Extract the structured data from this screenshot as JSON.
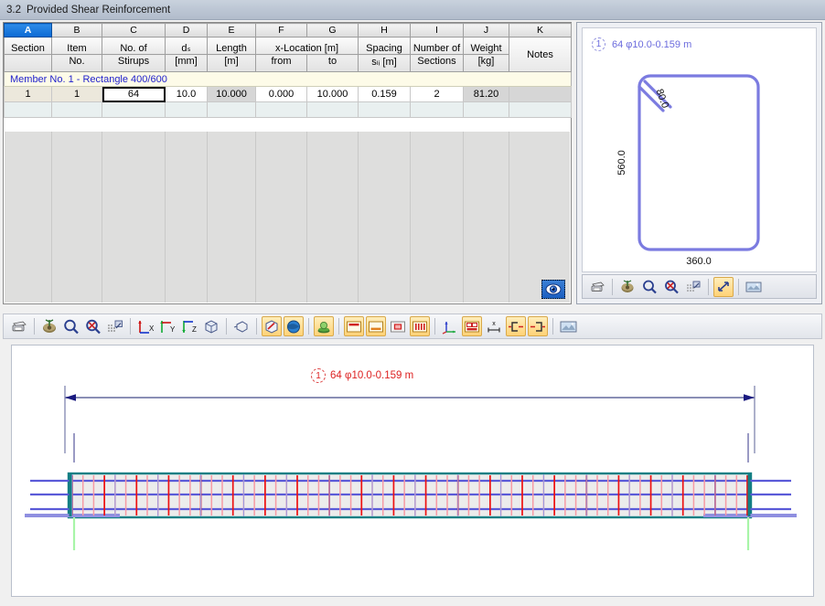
{
  "window": {
    "section_number": "3.2",
    "title": "Provided Shear Reinforcement"
  },
  "table": {
    "column_letters": [
      "A",
      "B",
      "C",
      "D",
      "E",
      "F",
      "G",
      "H",
      "I",
      "J",
      "K"
    ],
    "selected_column_letter": "A",
    "headers_line1": [
      "Section",
      "Item",
      "No. of",
      "d",
      "Length",
      "x-Location [m]",
      "",
      "Spacing",
      "Number of",
      "Weight",
      ""
    ],
    "headers": [
      {
        "l1": "Section",
        "l2": ""
      },
      {
        "l1": "Item",
        "l2": "No."
      },
      {
        "l1": "No. of",
        "l2": "Stirups"
      },
      {
        "l1": "dₛ",
        "l2": "[mm]"
      },
      {
        "l1": "Length",
        "l2": "[m]"
      },
      {
        "l1": "x-Location [m]",
        "l2": "from"
      },
      {
        "l1": "",
        "l2": "to"
      },
      {
        "l1": "Spacing",
        "l2": "sₗᵢ [m]"
      },
      {
        "l1": "Number of",
        "l2": "Sections"
      },
      {
        "l1": "Weight",
        "l2": "[kg]"
      },
      {
        "l1": "",
        "l2": "Notes"
      }
    ],
    "group_row_label": "Member No. 1  -  Rectangle 400/600",
    "rows": [
      {
        "section": "1",
        "item_no": "1",
        "no_of_stirrups": "64",
        "ds_mm": "10.0",
        "length_m": "10.000",
        "x_from": "0.000",
        "x_to": "10.000",
        "spacing_m": "0.159",
        "number_of_sections": "2",
        "weight_kg": "81.20",
        "notes": ""
      }
    ],
    "empty_rows": 1,
    "eye_button_name": "eye-icon"
  },
  "cross_section": {
    "rebar_label": "64 φ10.0-0.159 m",
    "callout_number": "1",
    "dim_height": "560.0",
    "dim_width": "360.0",
    "corner_dim": "80.0",
    "toolbar": [
      {
        "name": "print-icon",
        "label": "Print"
      },
      {
        "name": "render-icon",
        "label": "Render"
      },
      {
        "name": "zoom-in-icon",
        "label": "Zoom In"
      },
      {
        "name": "zoom-out-icon",
        "label": "Zoom Out"
      },
      {
        "name": "grid-snap-icon",
        "label": "Grid Snap"
      },
      {
        "name": "dimensions-icon",
        "label": "Show Dimensions",
        "active": true
      },
      {
        "name": "print-preview-icon",
        "label": "Print Preview"
      }
    ]
  },
  "main_view": {
    "rebar_label": "64 φ10.0-0.159 m",
    "callout_number": "1",
    "toolbar": [
      {
        "name": "print-icon",
        "label": "Print",
        "active": false
      },
      {
        "name": "render-icon",
        "label": "Render",
        "active": false
      },
      {
        "name": "zoom-in-icon",
        "label": "Zoom In",
        "active": false
      },
      {
        "name": "zoom-out-icon",
        "label": "Zoom Out",
        "active": false
      },
      {
        "name": "grid-snap-icon",
        "label": "Grid Snap",
        "active": false
      },
      {
        "name": "view-x-icon",
        "label": "View in X",
        "active": false
      },
      {
        "name": "view-y-icon",
        "label": "View in Y",
        "active": false
      },
      {
        "name": "view-z-icon",
        "label": "View in Z",
        "active": false
      },
      {
        "name": "isometric-view-icon",
        "label": "Isometric View",
        "active": false
      },
      {
        "name": "perspective-view-icon",
        "label": "Perspective",
        "active": false
      },
      {
        "name": "edit-model-icon",
        "label": "Edit Model",
        "active": true
      },
      {
        "name": "globe-icon",
        "label": "Global View",
        "active": true
      },
      {
        "name": "render-solid-icon",
        "label": "Solid Model",
        "active": false
      },
      {
        "name": "show-top-rebar-icon",
        "label": "Top Reinforcement",
        "active": true
      },
      {
        "name": "show-bottom-rebar-icon",
        "label": "Bottom Reinforcement",
        "active": true
      },
      {
        "name": "show-section-icon",
        "label": "Section View",
        "active": false
      },
      {
        "name": "show-stirrups-icon",
        "label": "Stirrups",
        "active": true
      },
      {
        "name": "axis-system-icon",
        "label": "Axis System",
        "active": false
      },
      {
        "name": "show-numbering-icon",
        "label": "Numbering",
        "active": true
      },
      {
        "name": "show-dimensions-icon",
        "label": "Dimensions",
        "active": false
      },
      {
        "name": "rebar-left-icon",
        "label": "Rebar Left End",
        "active": true
      },
      {
        "name": "rebar-right-icon",
        "label": "Rebar Right End",
        "active": true
      },
      {
        "name": "print-preview-icon",
        "label": "Print Preview",
        "active": false
      }
    ]
  },
  "colors": {
    "accent_blue": "#0a69d4",
    "group_text": "#2222cc",
    "label_red": "#dd2222",
    "rebar_blue": "#6b6bdd",
    "stirrup_red": "#ee1111",
    "stirrup_pink": "#f79aa4",
    "beam_outline": "#137f84",
    "dim_line": "#8a8fb5",
    "arrow_navy": "#1a1a80"
  }
}
